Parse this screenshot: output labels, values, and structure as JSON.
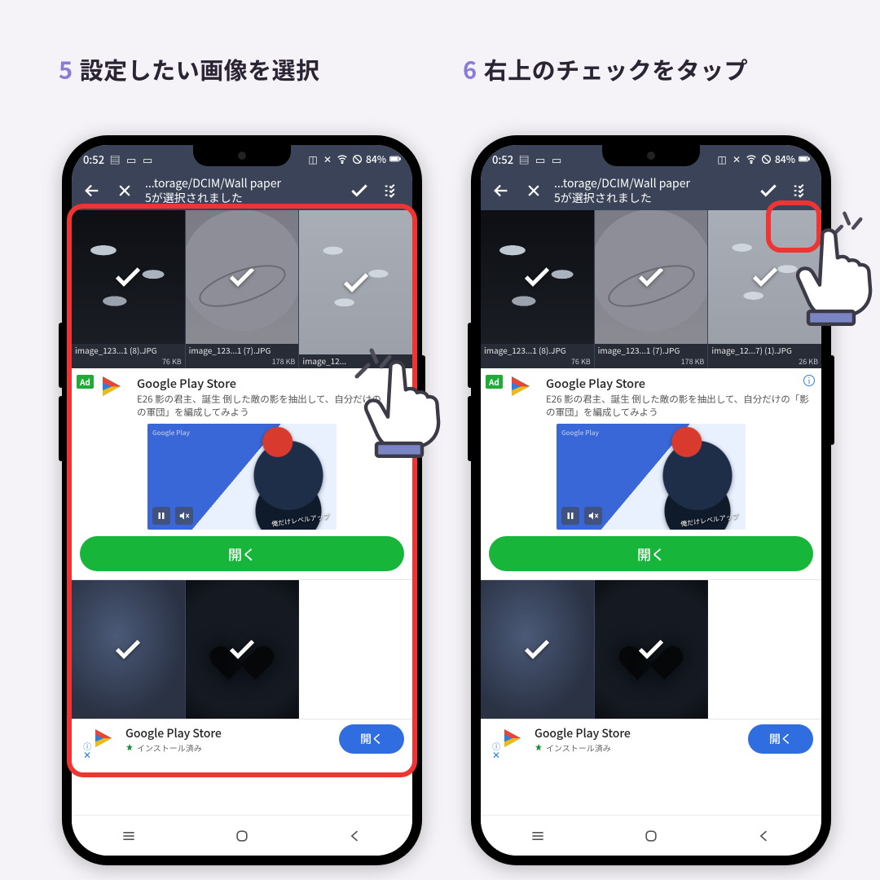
{
  "captions": {
    "step5_num": "5",
    "step5_text": "設定したい画像を選択",
    "step6_num": "6",
    "step6_text": "右上のチェックをタップ"
  },
  "status": {
    "time": "0:52",
    "battery": "84%"
  },
  "appbar": {
    "path": "...torage/DCIM/Wall paper",
    "selection": "5が選択されました"
  },
  "thumbs": [
    {
      "name": "image_123...1 (8).JPG",
      "size": "76 KB"
    },
    {
      "name": "image_123...1 (7).JPG",
      "size": "178 KB"
    },
    {
      "name_left": "image_12... ",
      "name_right": "image_12...7) (1).JPG",
      "size_right": "26 KB"
    }
  ],
  "ad": {
    "badge": "Ad",
    "title": "Google Play Store",
    "desc_left": "E26 影の君主、誕生 倒した敵の影を抽出して、自分だけの「影の軍団」を編成してみよう",
    "desc_right": "E26 影の君主、誕生 倒した敵の影を抽出して、自分だけの「影の軍団」を編成してみよう",
    "media_tag": "Google Play",
    "game_title": "俺だけレベルアップ",
    "cta": "開く"
  },
  "footer_ad": {
    "title": "Google Play Store",
    "installed": "インストール済み",
    "cta": "開く"
  }
}
